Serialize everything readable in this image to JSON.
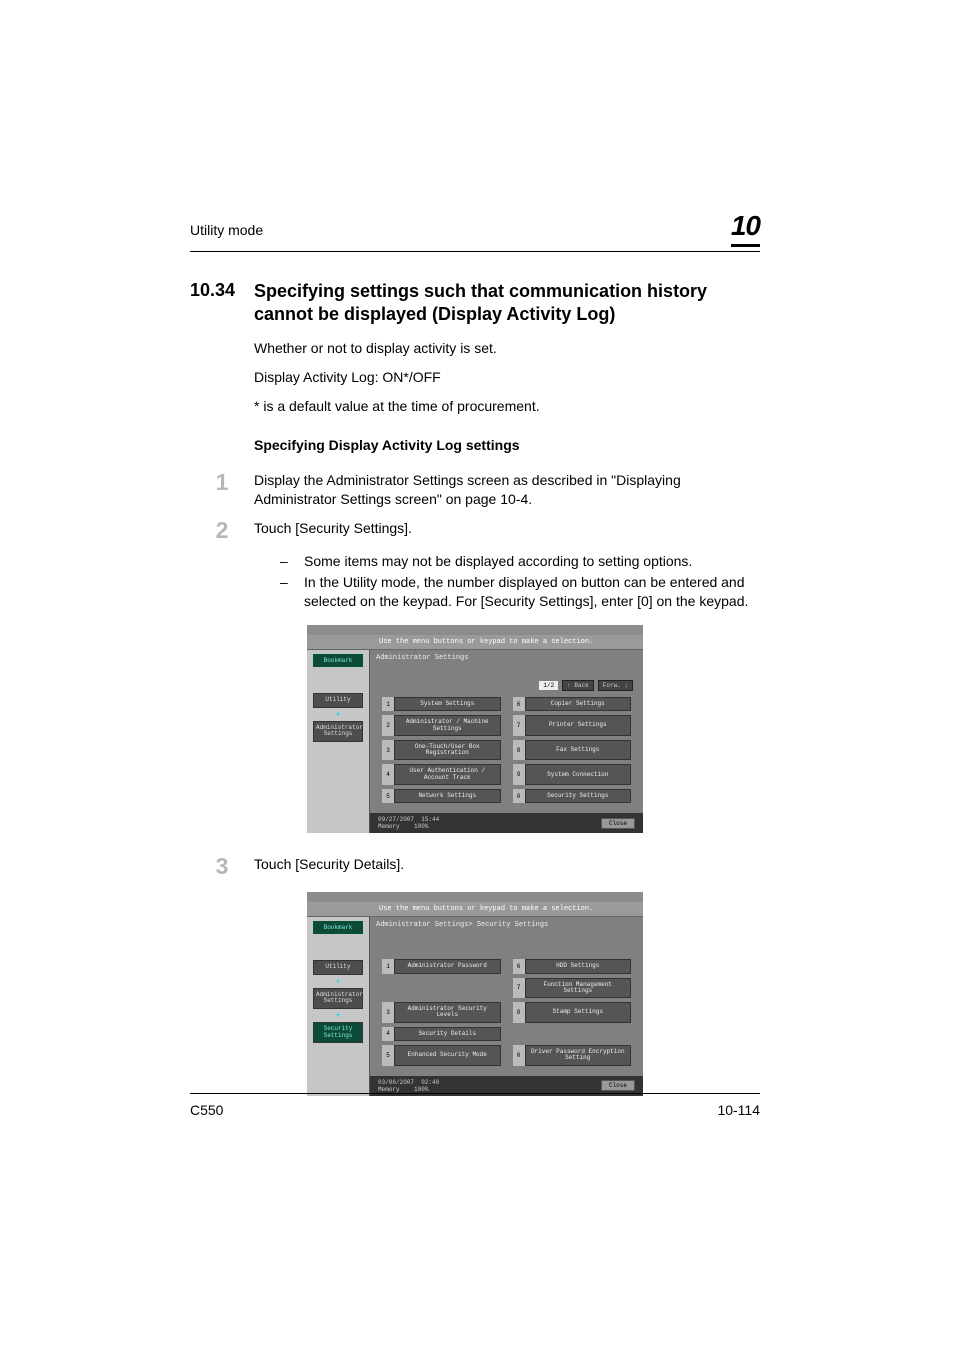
{
  "header": {
    "section": "Utility mode",
    "chapter": "10"
  },
  "h2": {
    "num": "10.34",
    "title": "Specifying settings such that communication history cannot be displayed (Display Activity Log)"
  },
  "intro": {
    "p1": "Whether or not to display activity is set.",
    "p2": "Display Activity Log: ON*/OFF",
    "p3": "* is a default value at the time of procurement."
  },
  "subheading": "Specifying Display Activity Log settings",
  "steps": {
    "s1": {
      "num": "1",
      "text": "Display the Administrator Settings screen as described in \"Displaying Administrator Settings screen\" on page 10-4."
    },
    "s2": {
      "num": "2",
      "text": "Touch [Security Settings].",
      "bullets": [
        "Some items may not be displayed according to setting options.",
        "In the Utility mode, the number displayed on button can be entered and selected on the keypad. For [Security Settings], enter [0] on the keypad."
      ]
    },
    "s3": {
      "num": "3",
      "text": "Touch [Security Details]."
    }
  },
  "screen1": {
    "instruction": "Use the menu buttons or keypad to make a selection.",
    "bookmark": "Bookmark",
    "side": [
      "Utility",
      "Administrator Settings"
    ],
    "breadcrumb": "Administrator Settings",
    "page": "1/2",
    "back": "Back",
    "forward": "Forw.",
    "items_left": [
      {
        "n": "1",
        "l": "System Settings"
      },
      {
        "n": "2",
        "l": "Administrator / Machine Settings"
      },
      {
        "n": "3",
        "l": "One-Touch/User Box Registration"
      },
      {
        "n": "4",
        "l": "User Authentication / Account Track"
      },
      {
        "n": "5",
        "l": "Network Settings"
      }
    ],
    "items_right": [
      {
        "n": "6",
        "l": "Copier Settings"
      },
      {
        "n": "7",
        "l": "Printer Settings"
      },
      {
        "n": "8",
        "l": "Fax Settings"
      },
      {
        "n": "9",
        "l": "System Connection"
      },
      {
        "n": "0",
        "l": "Security Settings"
      }
    ],
    "ts_date": "09/27/2007",
    "ts_time": "15:44",
    "mem": "Memory",
    "mem_pct": "100%",
    "close": "Close"
  },
  "screen2": {
    "instruction": "Use the menu buttons or keypad to make a selection.",
    "bookmark": "Bookmark",
    "side": [
      "Utility",
      "Administrator Settings",
      "Security Settings"
    ],
    "breadcrumb": "Administrator Settings> Security Settings",
    "items_left": [
      {
        "n": "1",
        "l": "Administrator Password"
      },
      {
        "n": "",
        "l": ""
      },
      {
        "n": "3",
        "l": "Administrator Security Levels"
      },
      {
        "n": "4",
        "l": "Security Details"
      },
      {
        "n": "5",
        "l": "Enhanced Security Mode"
      }
    ],
    "items_right": [
      {
        "n": "6",
        "l": "HDD Settings"
      },
      {
        "n": "7",
        "l": "Function Management Settings"
      },
      {
        "n": "8",
        "l": "Stamp Settings"
      },
      {
        "n": "",
        "l": ""
      },
      {
        "n": "0",
        "l": "Driver Password Encryption Setting"
      }
    ],
    "ts_date": "03/06/2007",
    "ts_time": "02:48",
    "mem": "Memory",
    "mem_pct": "100%",
    "close": "Close"
  },
  "footer": {
    "left": "C550",
    "right": "10-114"
  }
}
